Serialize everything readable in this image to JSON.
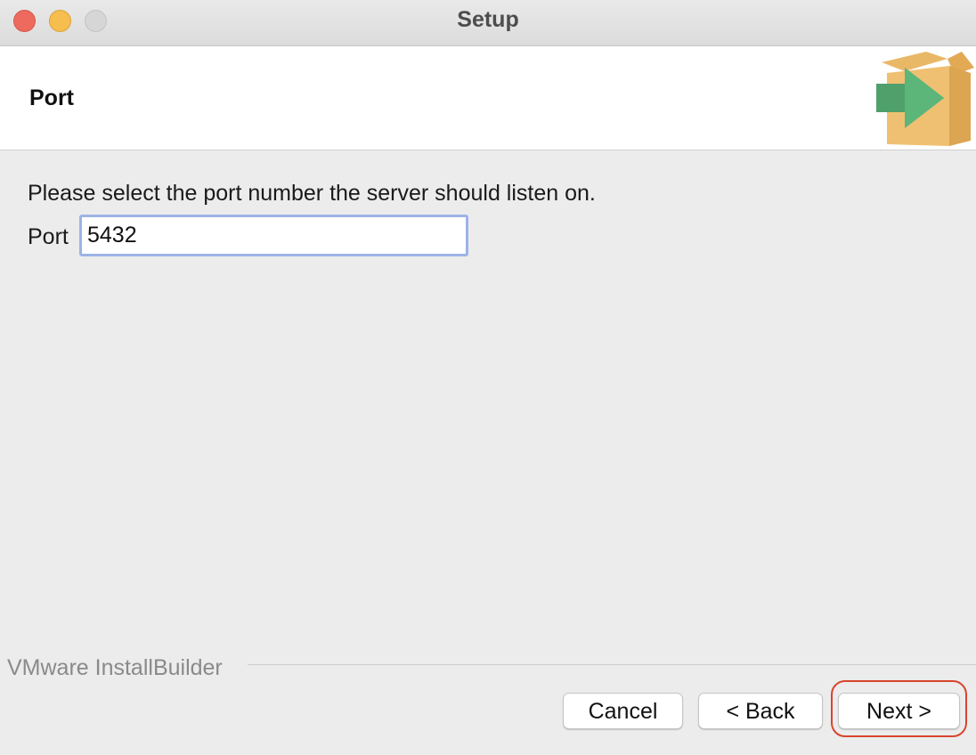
{
  "window": {
    "title": "Setup",
    "traffic_lights": {
      "close": "#ee6a5f",
      "minimize": "#f5be4f",
      "zoom": "#d6d6d6"
    }
  },
  "header": {
    "page_title": "Port",
    "icon": "package-box-arrow-icon"
  },
  "content": {
    "instruction": "Please select the port number the server should listen on.",
    "port_label": "Port",
    "port_value": "5432"
  },
  "footer": {
    "brand": "VMware InstallBuilder",
    "buttons": {
      "cancel": "Cancel",
      "back": "< Back",
      "next": "Next >"
    },
    "highlight_color": "#d9442e"
  }
}
